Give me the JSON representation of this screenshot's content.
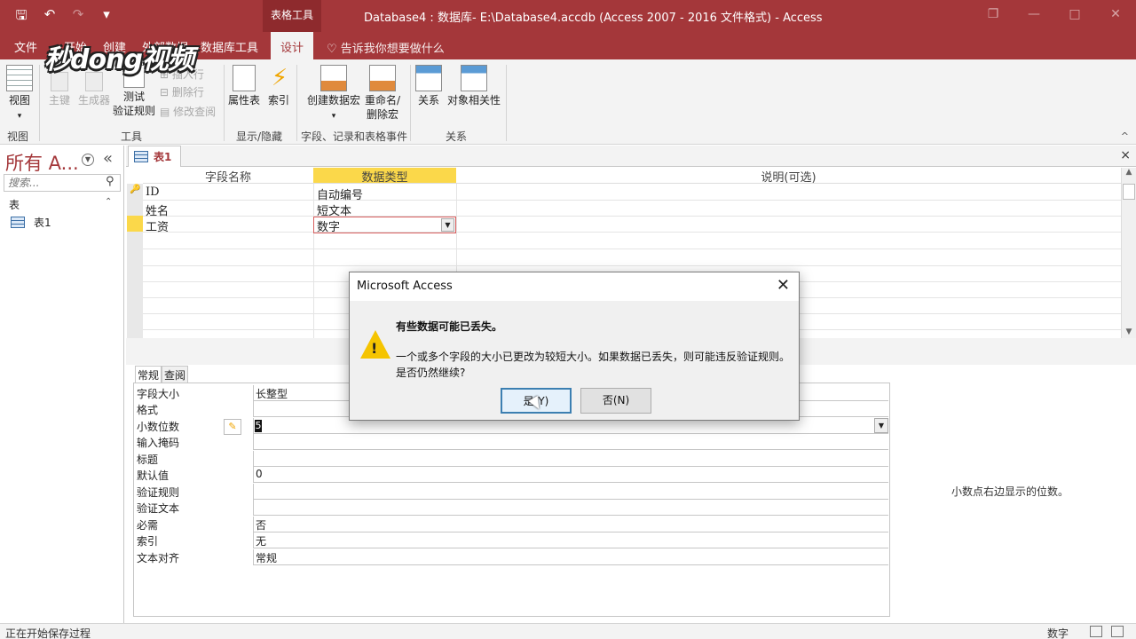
{
  "titlebar": {
    "context_tab_group": "表格工具",
    "window_title": "Database4 : 数据库- E:\\Database4.accdb (Access 2007 - 2016 文件格式)  -  Access",
    "qat": {
      "save": "🖫",
      "undo": "↶",
      "redo": "↷",
      "customize": "▾"
    },
    "buttons": {
      "restore": "❐",
      "minimize": "—",
      "maximize": "□",
      "close": "✕"
    }
  },
  "ribbon_tabs": {
    "file": "文件",
    "home": "开始",
    "create": "创建",
    "external": "外部数据",
    "dbtools": "数据库工具",
    "design": "设计",
    "tell_me": "告诉我你想要做什么"
  },
  "watermark": "秒dong视频",
  "ribbon": {
    "view": {
      "label": "视图",
      "group": "视图"
    },
    "tools": {
      "primary_key": "主键",
      "builder": "生成器",
      "test_validation": [
        "测试",
        "验证规则"
      ],
      "insert_row": "插入行",
      "delete_row": "删除行",
      "modify_lookup": "修改查阅",
      "group": "工具"
    },
    "show_hide": {
      "property_sheet": "属性表",
      "indexes": "索引",
      "group": "显示/隐藏"
    },
    "events": {
      "create_macro": "创建数据宏",
      "rename_macro": [
        "重命名/",
        "删除宏"
      ],
      "group": "字段、记录和表格事件"
    },
    "relationships": {
      "relationships": "关系",
      "dependencies": "对象相关性",
      "group": "关系"
    },
    "collapse": "^"
  },
  "nav": {
    "title": "所有 A...",
    "search_placeholder": "搜索...",
    "category": "表",
    "items": [
      {
        "label": "表1"
      }
    ]
  },
  "document": {
    "tab_label": "表1",
    "close": "×",
    "columns": [
      "字段名称",
      "数据类型",
      "说明(可选)"
    ],
    "rows": [
      {
        "name": "ID",
        "type": "自动编号"
      },
      {
        "name": "姓名",
        "type": "短文本"
      },
      {
        "name": "工资",
        "type": "数字"
      }
    ]
  },
  "properties": {
    "tabs": [
      "常规",
      "查阅"
    ],
    "rows": [
      {
        "label": "字段大小",
        "value": "长整型"
      },
      {
        "label": "格式",
        "value": ""
      },
      {
        "label": "小数位数",
        "value": "5"
      },
      {
        "label": "输入掩码",
        "value": ""
      },
      {
        "label": "标题",
        "value": ""
      },
      {
        "label": "默认值",
        "value": "0"
      },
      {
        "label": "验证规则",
        "value": ""
      },
      {
        "label": "验证文本",
        "value": ""
      },
      {
        "label": "必需",
        "value": "否"
      },
      {
        "label": "索引",
        "value": "无"
      },
      {
        "label": "文本对齐",
        "value": "常规"
      }
    ],
    "help_text": "小数点右边显示的位数。"
  },
  "dialog": {
    "title": "Microsoft Access",
    "heading": "有些数据可能已丢失。",
    "message_line1": "一个或多个字段的大小已更改为较短大小。如果数据已丢失，则可能违反验证规则。",
    "message_line2": "是否仍然继续?",
    "yes": "是(Y)",
    "no": "否(N)",
    "close": "✕"
  },
  "status": {
    "left": "正在开始保存过程",
    "mode": "数字"
  },
  "colors": {
    "accent": "#a4373a",
    "header_active": "#fbd84a",
    "warning": "#f5c400"
  }
}
